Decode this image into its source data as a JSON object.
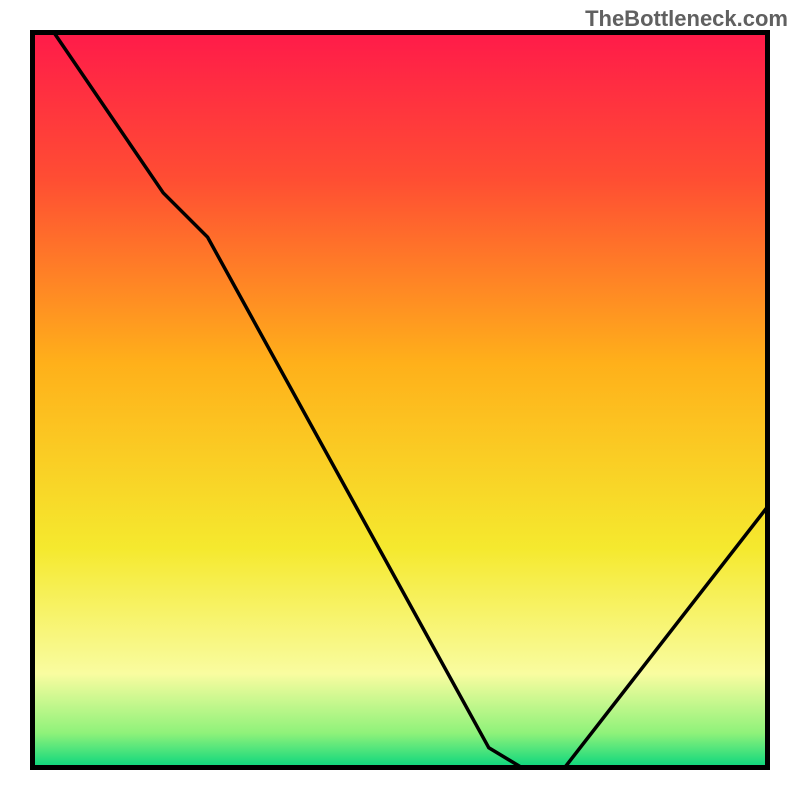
{
  "watermark": "TheBottleneck.com",
  "chart_data": {
    "type": "line",
    "title": "",
    "xlabel": "",
    "ylabel": "",
    "xlim": [
      0,
      100
    ],
    "ylim": [
      0,
      100
    ],
    "gradient_stops": [
      {
        "offset": 0,
        "color": "#ff1a4a"
      },
      {
        "offset": 20,
        "color": "#ff4d33"
      },
      {
        "offset": 45,
        "color": "#ffb01a"
      },
      {
        "offset": 70,
        "color": "#f5e92e"
      },
      {
        "offset": 87,
        "color": "#f9fca0"
      },
      {
        "offset": 95,
        "color": "#8ff27a"
      },
      {
        "offset": 100,
        "color": "#00d47e"
      }
    ],
    "series": [
      {
        "name": "bottleneck-curve",
        "type": "line",
        "color": "#000000",
        "x": [
          3,
          18,
          24,
          62,
          67,
          72,
          100
        ],
        "y": [
          100,
          78,
          72,
          3,
          0,
          0,
          36
        ]
      }
    ],
    "marker": {
      "name": "optimal-point",
      "x": 69,
      "y": 0,
      "color": "#e86a6a",
      "width_pct": 5,
      "height_pct": 1.2
    },
    "frame_color": "#000000",
    "frame_stroke": 5
  }
}
